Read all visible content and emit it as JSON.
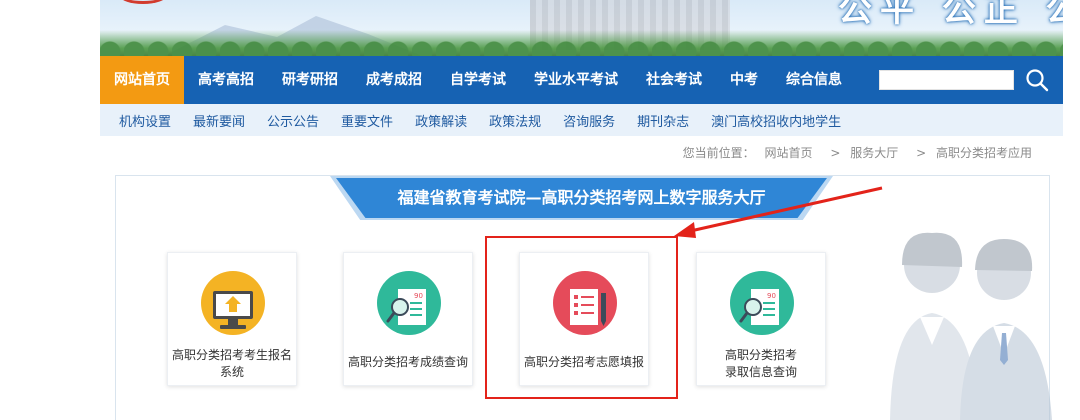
{
  "banner": {
    "slogan": "公平 公正 公开"
  },
  "main_nav": {
    "items": [
      "网站首页",
      "高考高招",
      "研考研招",
      "成考成招",
      "自学考试",
      "学业水平考试",
      "社会考试",
      "中考",
      "综合信息"
    ],
    "active_index": 0,
    "search_placeholder": ""
  },
  "sub_nav": {
    "items": [
      "机构设置",
      "最新要闻",
      "公示公告",
      "重要文件",
      "政策解读",
      "政策法规",
      "咨询服务",
      "期刊杂志",
      "澳门高校招收内地学生"
    ]
  },
  "breadcrumb": {
    "prefix": "您当前位置：",
    "items": [
      "网站首页",
      "服务大厅",
      "高职分类招考应用"
    ],
    "separator": ">"
  },
  "service_hall": {
    "title": "福建省教育考试院—高职分类招考网上数字服务大厅",
    "cards": [
      {
        "label": "高职分类招考考生报名系统",
        "icon": "computer-upload-icon",
        "color": "#f4b324"
      },
      {
        "label": "高职分类招考成绩查询",
        "icon": "score-report-search-icon",
        "color": "#2fb99a"
      },
      {
        "label": "高职分类招考志愿填报",
        "icon": "application-form-pen-icon",
        "color": "#e54b5a"
      },
      {
        "label": "高职分类招考录取信息查询",
        "icon": "admission-search-icon",
        "color": "#2fb99a"
      }
    ],
    "highlighted_index": 2
  },
  "colors": {
    "nav_bg": "#1662b3",
    "nav_active": "#f39a12",
    "subnav_bg": "#e8f1fa",
    "title_banner": "#2f86d6",
    "highlight": "#e3231a"
  }
}
